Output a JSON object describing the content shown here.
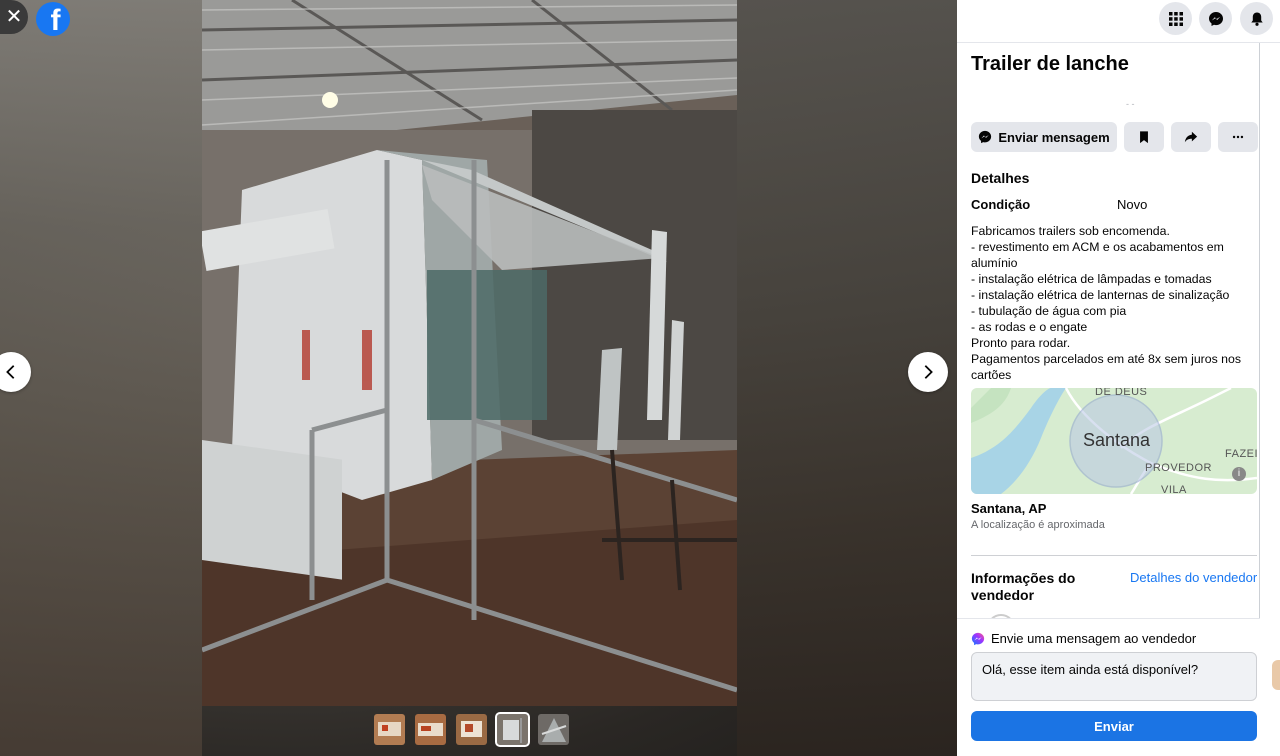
{
  "viewer": {
    "close_icon": "close-icon",
    "logo": "facebook-logo",
    "prev_icon": "chevron-left-icon",
    "next_icon": "chevron-right-icon",
    "photo_subject": "metal food trailer frame under construction in workshop",
    "thumbnail_count": 5,
    "active_thumbnail": 4
  },
  "topbar": {
    "icons": [
      "menu-grid-icon",
      "messenger-icon",
      "notifications-bell-icon"
    ]
  },
  "listing": {
    "title": "Trailer de lanche",
    "actions": {
      "message_label": "Enviar mensagem",
      "save_icon": "bookmark-icon",
      "share_icon": "share-arrow-icon",
      "more_icon": "more-dots-icon"
    },
    "details_heading": "Detalhes",
    "condition_label": "Condição",
    "condition_value": "Novo",
    "description": "Fabricamos trailers sob encomenda.\n- revestimento em ACM e os acabamentos em alumínio\n- instalação elétrica de lâmpadas e tomadas\n- instalação elétrica de lanternas de sinalização\n- tubulação de água com pia\n- as rodas e o engate\nPronto para rodar.\nPagamentos parcelados em até 8x sem juros nos cartões",
    "map": {
      "city_label": "Santana",
      "labels": [
        "DE DEUS",
        "PROVEDOR",
        "FAZEI",
        "VILA"
      ]
    },
    "location": "Santana, AP",
    "location_note": "A localização é aproximada",
    "seller_heading": "Informações do vendedor",
    "seller_link": "Detalhes do vendedor"
  },
  "message": {
    "heading": "Envie uma mensagem ao vendedor",
    "input_value": "Olá, esse item ainda está disponível?",
    "send_label": "Enviar"
  },
  "colors": {
    "accent": "#1877f2",
    "send_button": "#1b74e4",
    "button_bg": "#e4e6eb"
  }
}
